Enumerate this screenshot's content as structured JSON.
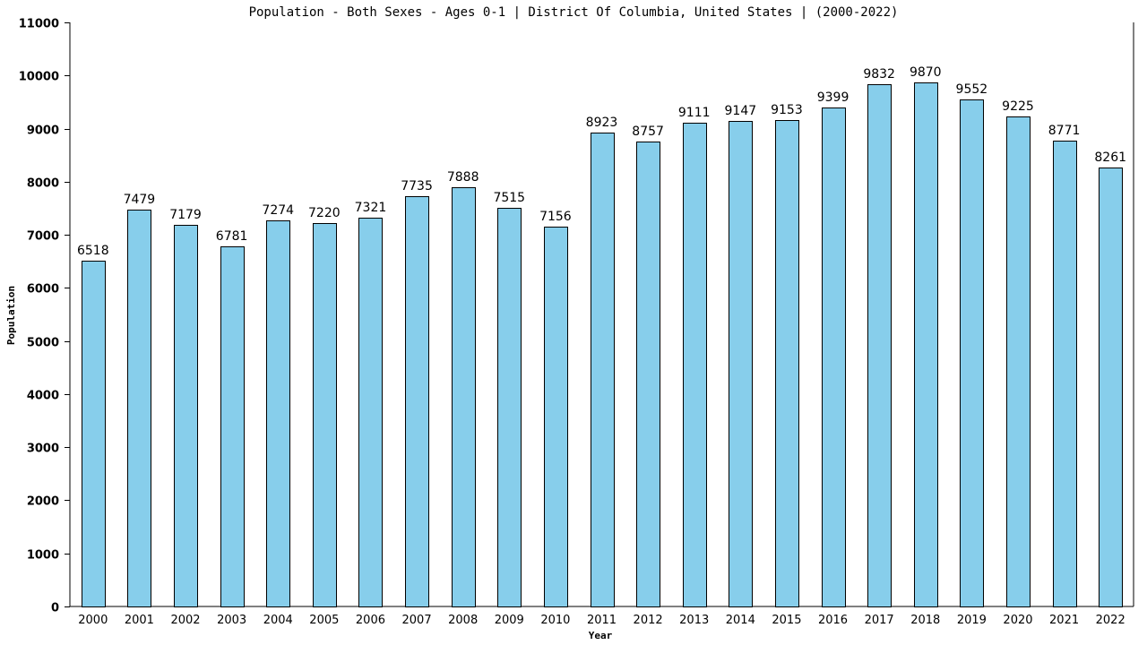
{
  "chart_data": {
    "type": "bar",
    "title": "Population - Both Sexes - Ages 0-1 | District Of Columbia, United States |  (2000-2022)",
    "xlabel": "Year",
    "ylabel": "Population",
    "ylim": [
      0,
      11000
    ],
    "yticks": [
      0,
      1000,
      2000,
      3000,
      4000,
      5000,
      6000,
      7000,
      8000,
      9000,
      10000,
      11000
    ],
    "grid": false,
    "legend": "none",
    "categories": [
      "2000",
      "2001",
      "2002",
      "2003",
      "2004",
      "2005",
      "2006",
      "2007",
      "2008",
      "2009",
      "2010",
      "2011",
      "2012",
      "2013",
      "2014",
      "2015",
      "2016",
      "2017",
      "2018",
      "2019",
      "2020",
      "2021",
      "2022"
    ],
    "values": [
      6518,
      7479,
      7179,
      6781,
      7274,
      7220,
      7321,
      7735,
      7888,
      7515,
      7156,
      8923,
      8757,
      9111,
      9147,
      9153,
      9399,
      9832,
      9870,
      9552,
      9225,
      8771,
      8261
    ],
    "colors": {
      "bar_fill": "#87ceeb",
      "bar_stroke": "#000000"
    }
  }
}
